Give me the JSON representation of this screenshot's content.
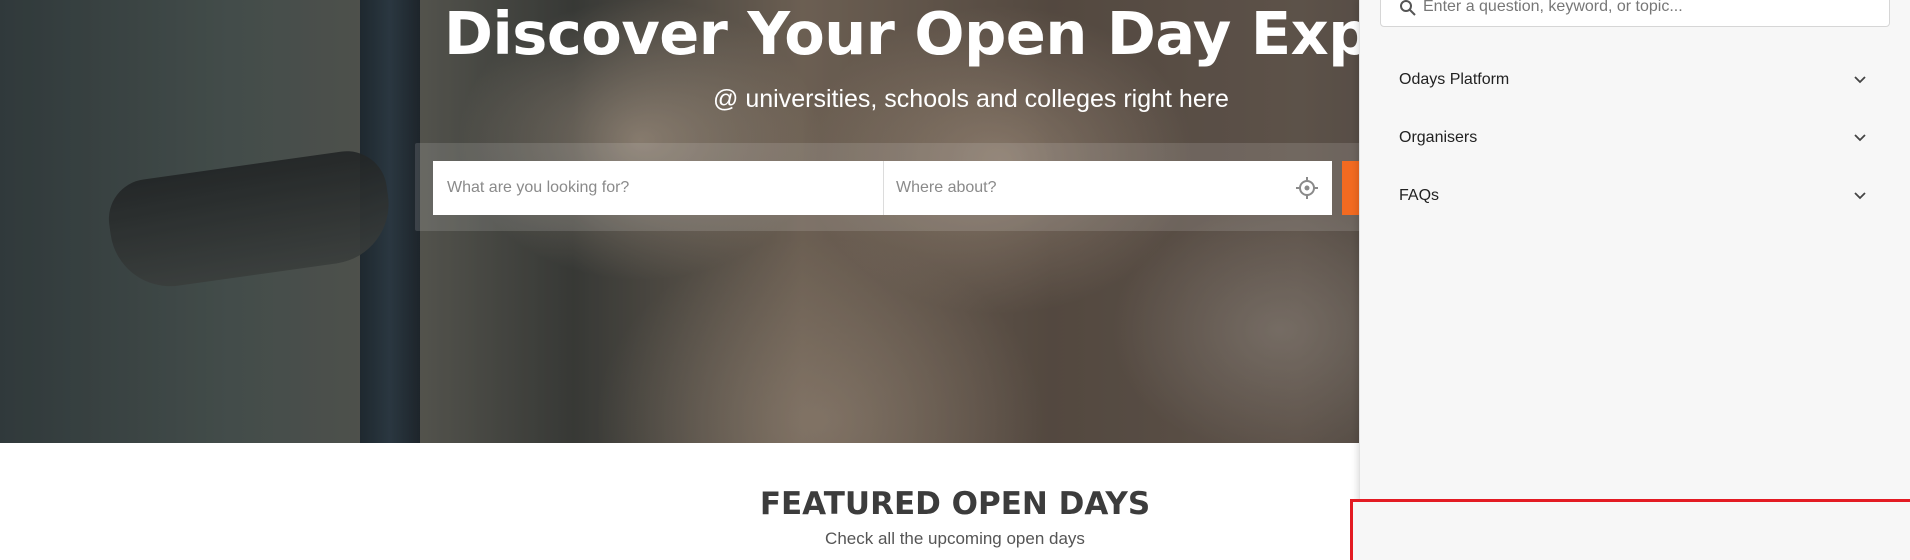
{
  "hero": {
    "title": "Discover Your Open Day Experie",
    "subtitle": "@ universities, schools and colleges right here",
    "search": {
      "what_placeholder": "What are you looking for?",
      "where_placeholder": "Where about?"
    }
  },
  "featured": {
    "title": "FEATURED OPEN DAYS",
    "subtitle": "Check all the upcoming open days"
  },
  "help_panel": {
    "search_placeholder": "Enter a question, keyword, or topic...",
    "items": [
      {
        "label": "Odays Platform",
        "icon": "chevron-down-icon"
      },
      {
        "label": "Organisers",
        "icon": "chevron-down-icon"
      },
      {
        "label": "FAQs",
        "icon": "chevron-down-icon"
      }
    ]
  },
  "colors": {
    "accent": "#f26a21",
    "highlight_border": "#e31b23",
    "panel_bg": "#f7f7f7"
  }
}
